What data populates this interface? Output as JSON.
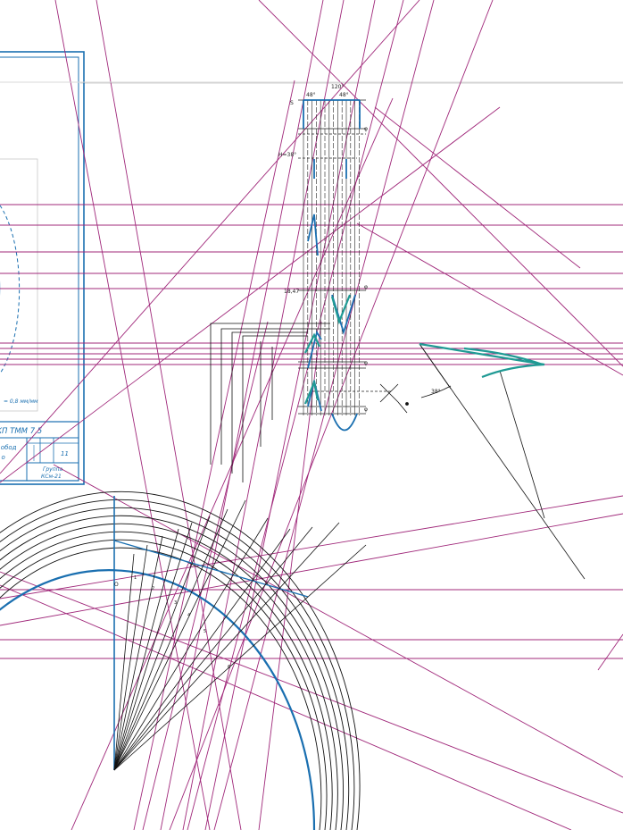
{
  "colors": {
    "construction": "#a0287a",
    "outline": "#1a6fb0",
    "ink": "#111111",
    "teal": "#1f9a94",
    "grid": "#d8d8d8"
  },
  "title_block": {
    "code": "КП ТММ 7.5",
    "desc_line1": "н обод",
    "desc_line2": "м о",
    "sheet_count": "11",
    "group_label": "Группа",
    "group_value": "КСм-21",
    "scale_note": "= 0,8 мм/мм"
  },
  "cam_profile": {
    "label_phi_1": "φ",
    "label_phi_2": "φ",
    "label_phi_3": "φ",
    "label_phi_4": "φ",
    "dim_48_left": "48°",
    "dim_48_right": "48°",
    "dim_top": "120°",
    "dim_h": "H=38°",
    "dim_s": "S",
    "dim_l": "18,47",
    "angle_label": "38°"
  },
  "gear_labels": {
    "o_label": "O",
    "num_labels": [
      "1",
      "2",
      "3",
      "4",
      "5",
      "6"
    ]
  }
}
